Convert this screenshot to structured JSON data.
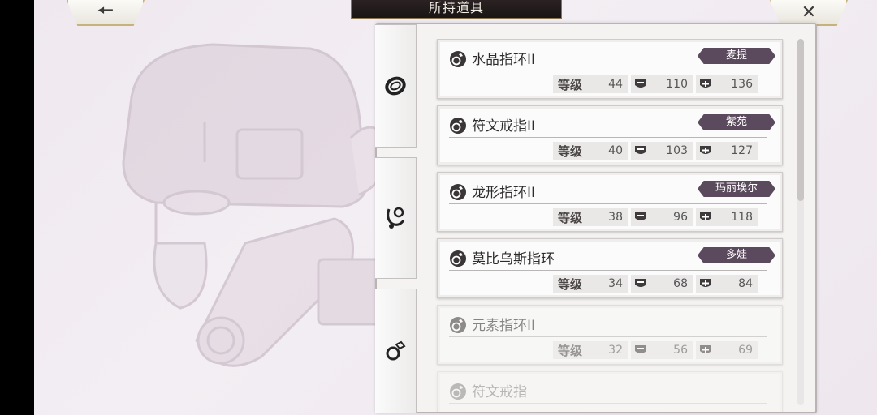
{
  "header": {
    "title": "所持道具",
    "back_icon": "left-arrow-icon",
    "close_icon": "close-icon"
  },
  "tabs": [
    {
      "icon": "bracelet-icon"
    },
    {
      "icon": "necklace-icon"
    },
    {
      "icon": "ring-icon"
    }
  ],
  "labels": {
    "level": "等级"
  },
  "items": [
    {
      "name": "水晶指环II",
      "owner": "麦提",
      "level": "44",
      "def": "110",
      "res": "136"
    },
    {
      "name": "符文戒指II",
      "owner": "紫苑",
      "level": "40",
      "def": "103",
      "res": "127"
    },
    {
      "name": "龙形指环II",
      "owner": "玛丽埃尔",
      "level": "38",
      "def": "96",
      "res": "118"
    },
    {
      "name": "莫比乌斯指环",
      "owner": "多娃",
      "level": "34",
      "def": "68",
      "res": "84"
    },
    {
      "name": "元素指环II",
      "owner": "",
      "level": "32",
      "def": "56",
      "res": "69"
    },
    {
      "name": "符文戒指",
      "owner": "",
      "level": "",
      "def": "",
      "res": ""
    }
  ]
}
